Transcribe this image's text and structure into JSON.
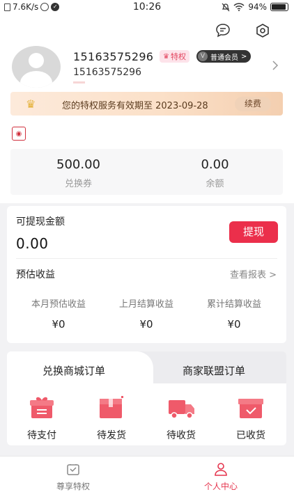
{
  "status_bar": {
    "speed": "7.6K/s",
    "time": "10:26",
    "battery": "94%"
  },
  "profile": {
    "phone": "15163575296",
    "nickname": "15163575296",
    "privilege_badge": "特权",
    "member_badge": "普通会员",
    "member_badge_chevron": ">",
    "member_icon_letter": "V"
  },
  "vip_bar": {
    "text": "您的特权服务有效期至 2023-09-28",
    "renew_label": "续费"
  },
  "stats": [
    {
      "value": "500.00",
      "label": "兑换券"
    },
    {
      "value": "0.00",
      "label": "余额"
    }
  ],
  "earnings": {
    "withdrawable_title": "可提现金额",
    "withdrawable_amount": "0.00",
    "withdraw_button": "提现",
    "estimate_title": "预估收益",
    "report_link": "查看报表 >",
    "columns": [
      {
        "label": "本月预估收益",
        "value": "¥0"
      },
      {
        "label": "上月结算收益",
        "value": "¥0"
      },
      {
        "label": "累计结算收益",
        "value": "¥0"
      }
    ]
  },
  "orders": {
    "tabs": [
      "兑换商城订单",
      "商家联盟订单"
    ],
    "items": [
      {
        "label": "待支付",
        "icon": "gift-box-icon"
      },
      {
        "label": "待发货",
        "icon": "package-icon"
      },
      {
        "label": "待收货",
        "icon": "delivery-truck-icon"
      },
      {
        "label": "已收货",
        "icon": "received-box-icon"
      }
    ]
  },
  "bottom_nav": [
    {
      "label": "尊享特权",
      "active": false
    },
    {
      "label": "个人中心",
      "active": true
    }
  ],
  "colors": {
    "accent": "#eb2f4b",
    "vip_text": "#5a3b1e",
    "active_nav": "#e5344d"
  }
}
